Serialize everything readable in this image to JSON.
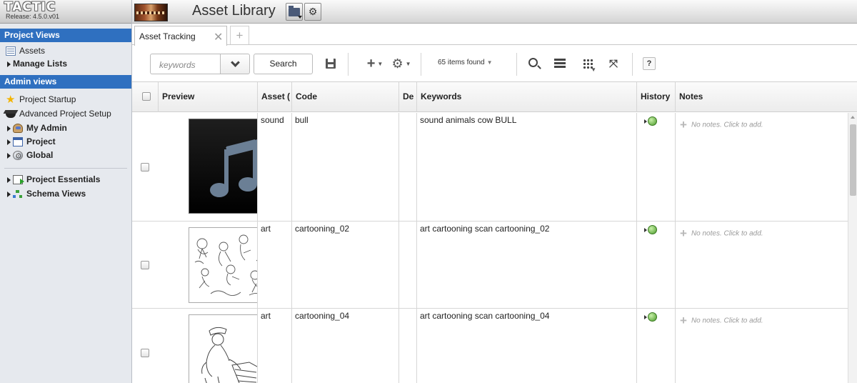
{
  "brand": {
    "logo": "TACTIC",
    "release": "Release: 4.5.0.v01"
  },
  "sidebar": {
    "project_views_title": "Project Views",
    "project_items": [
      {
        "label": "Assets",
        "icon": "table-icon"
      },
      {
        "label": "Manage Lists",
        "icon": "expand-triangle-icon"
      }
    ],
    "admin_views_title": "Admin views",
    "admin_items": [
      {
        "label": "Project Startup",
        "icon": "star-icon"
      },
      {
        "label": "Advanced Project Setup",
        "icon": "graduation-cap-icon"
      },
      {
        "label": "My Admin",
        "icon": "admin-user-icon"
      },
      {
        "label": "Project",
        "icon": "window-icon"
      },
      {
        "label": "Global",
        "icon": "globe-gear-icon"
      }
    ],
    "extra_items": [
      {
        "label": "Project Essentials",
        "icon": "essentials-icon"
      },
      {
        "label": "Schema Views",
        "icon": "schema-icon"
      }
    ]
  },
  "topbar": {
    "title": "Asset Library",
    "open_icon": "folder-open-icon",
    "settings_icon": "gear-icon"
  },
  "tabs": [
    {
      "label": "Asset Tracking"
    }
  ],
  "toolbar": {
    "keywords_placeholder": "keywords",
    "search_label": "Search",
    "items_found": "65 items found",
    "help_label": "?"
  },
  "columns": [
    "Preview",
    "Asset (",
    "Code",
    "De",
    "Keywords",
    "History",
    "Notes"
  ],
  "rows": [
    {
      "asset_category": "sound",
      "code": "bull",
      "keywords": "sound animals cow BULL",
      "notes": "No notes. Click to add.",
      "preview": "music-note-thumbnail"
    },
    {
      "asset_category": "art",
      "code": "cartooning_02",
      "keywords": "art cartooning scan cartooning_02",
      "notes": "No notes. Click to add.",
      "preview": "sketch-thumbnail"
    },
    {
      "asset_category": "art",
      "code": "cartooning_04",
      "keywords": "art cartooning scan cartooning_04",
      "notes": "No notes. Click to add.",
      "preview": "sketch-thumbnail"
    }
  ],
  "colors": {
    "section_header": "#2f70c0",
    "sidebar_bg": "#e6e9ee",
    "history_green": "#4a9a2a"
  }
}
